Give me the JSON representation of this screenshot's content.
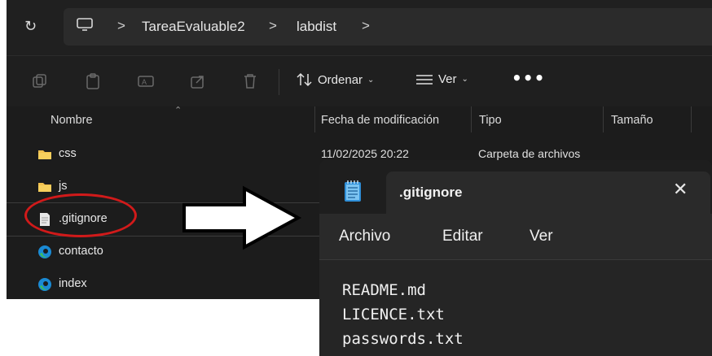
{
  "explorer": {
    "address": {
      "breadcrumbs": [
        "TareaEvaluable2",
        "labdist"
      ],
      "separator": ">"
    },
    "toolbar": {
      "sort_label": "Ordenar",
      "view_label": "Ver",
      "more_label": "•••",
      "icons": [
        "copy-icon",
        "paste-icon",
        "rename-icon",
        "share-icon",
        "delete-icon",
        "sort-icon",
        "view-icon"
      ]
    },
    "columns": {
      "name": "Nombre",
      "date": "Fecha de modificación",
      "type": "Tipo",
      "size": "Tamaño"
    },
    "files": [
      {
        "name": "css",
        "icon": "folder-icon",
        "date": "11/02/2025 20:22",
        "type": "Carpeta de archivos"
      },
      {
        "name": "js",
        "icon": "folder-icon"
      },
      {
        "name": ".gitignore",
        "icon": "text-file-icon",
        "selected": true
      },
      {
        "name": "contacto",
        "icon": "edge-icon"
      },
      {
        "name": "index",
        "icon": "edge-icon"
      }
    ]
  },
  "notepad": {
    "title": ".gitignore",
    "close_label": "✕",
    "menu": [
      "Archivo",
      "Editar",
      "Ver"
    ],
    "lines": [
      "README.md",
      "LICENCE.txt",
      "passwords.txt"
    ]
  },
  "colors": {
    "highlight_circle": "#d11a1a",
    "folder": "#f2c14e",
    "edge_blue": "#1a8ad4",
    "edge_green": "#3cc15a"
  }
}
